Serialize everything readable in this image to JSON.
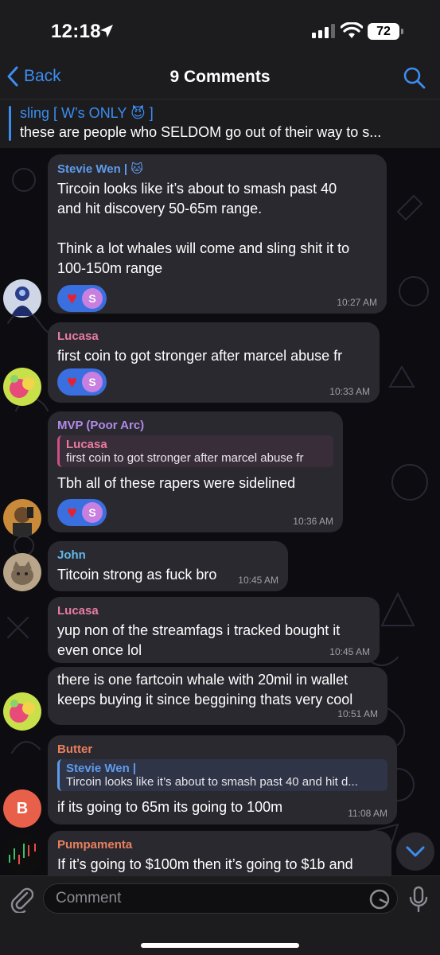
{
  "status": {
    "time": "12:18",
    "battery": "72"
  },
  "nav": {
    "back_label": "Back",
    "title": "9 Comments"
  },
  "pinned": {
    "name": "sling [ W’s ONLY 😈 ]",
    "text": "these are people who SELDOM go out of their way to s..."
  },
  "messages": [
    {
      "sender": "Stevie Wen | 🐱",
      "sender_color": "#5d9cec",
      "lines": [
        "Tircoin looks like it’s about to smash past 40",
        "and hit discovery 50-65m range.",
        "",
        "Think a lot whales will come and sling shit it to",
        "100-150m range"
      ],
      "reaction": "♥",
      "reaction_user": "S",
      "time": "10:27 AM"
    },
    {
      "sender": "Lucasa",
      "sender_color": "#e87da0",
      "lines": [
        "first coin to got stronger after marcel abuse fr"
      ],
      "reaction": "♥",
      "reaction_user": "S",
      "time": "10:33 AM"
    },
    {
      "sender": "MVP (Poor Arc)",
      "sender_color": "#b18ae8",
      "quote_name": "Lucasa",
      "quote_text": "first coin to got stronger after marcel abuse fr",
      "lines": [
        "Tbh all of these rapers were sidelined"
      ],
      "reaction": "♥",
      "reaction_user": "S",
      "time": "10:36 AM"
    },
    {
      "sender": "John",
      "sender_color": "#5fb7e8",
      "lines": [
        "Titcoin strong as fuck bro"
      ],
      "time": "10:45 AM"
    },
    {
      "sender": "Lucasa",
      "sender_color": "#e87da0",
      "lines": [
        "yup non of the streamfags i tracked bought it",
        "even once lol"
      ],
      "time": "10:45 AM"
    },
    {
      "lines": [
        "there is one fartcoin whale with 20mil in wallet",
        "keeps buying it since beggining thats very cool"
      ],
      "time": "10:51 AM"
    },
    {
      "sender": "Butter",
      "sender_color": "#e8805f",
      "quote_name": "Stevie Wen |",
      "quote_text": "Tircoin looks like it’s about to smash past 40 and hit d...",
      "lines": [
        "if its going to 65m its going to 100m"
      ],
      "time": "11:08 AM",
      "avatar_letter": "B"
    },
    {
      "sender": "Pumpamenta",
      "sender_color": "#e8805f",
      "lines": [
        "If it’s going to $100m then it’s going to $1b and"
      ]
    }
  ],
  "input": {
    "placeholder": "Comment"
  },
  "colors": {
    "accent": "#3b8ef0",
    "bubble": "#2b2930",
    "reaction": "#3a6fe0",
    "heart": "#e4222f"
  },
  "icons": [
    "location-arrow-icon",
    "signal-icon",
    "wifi-icon",
    "chevron-left-icon",
    "search-icon",
    "paperclip-icon",
    "sticker-icon",
    "microphone-icon",
    "chevron-down-icon"
  ]
}
